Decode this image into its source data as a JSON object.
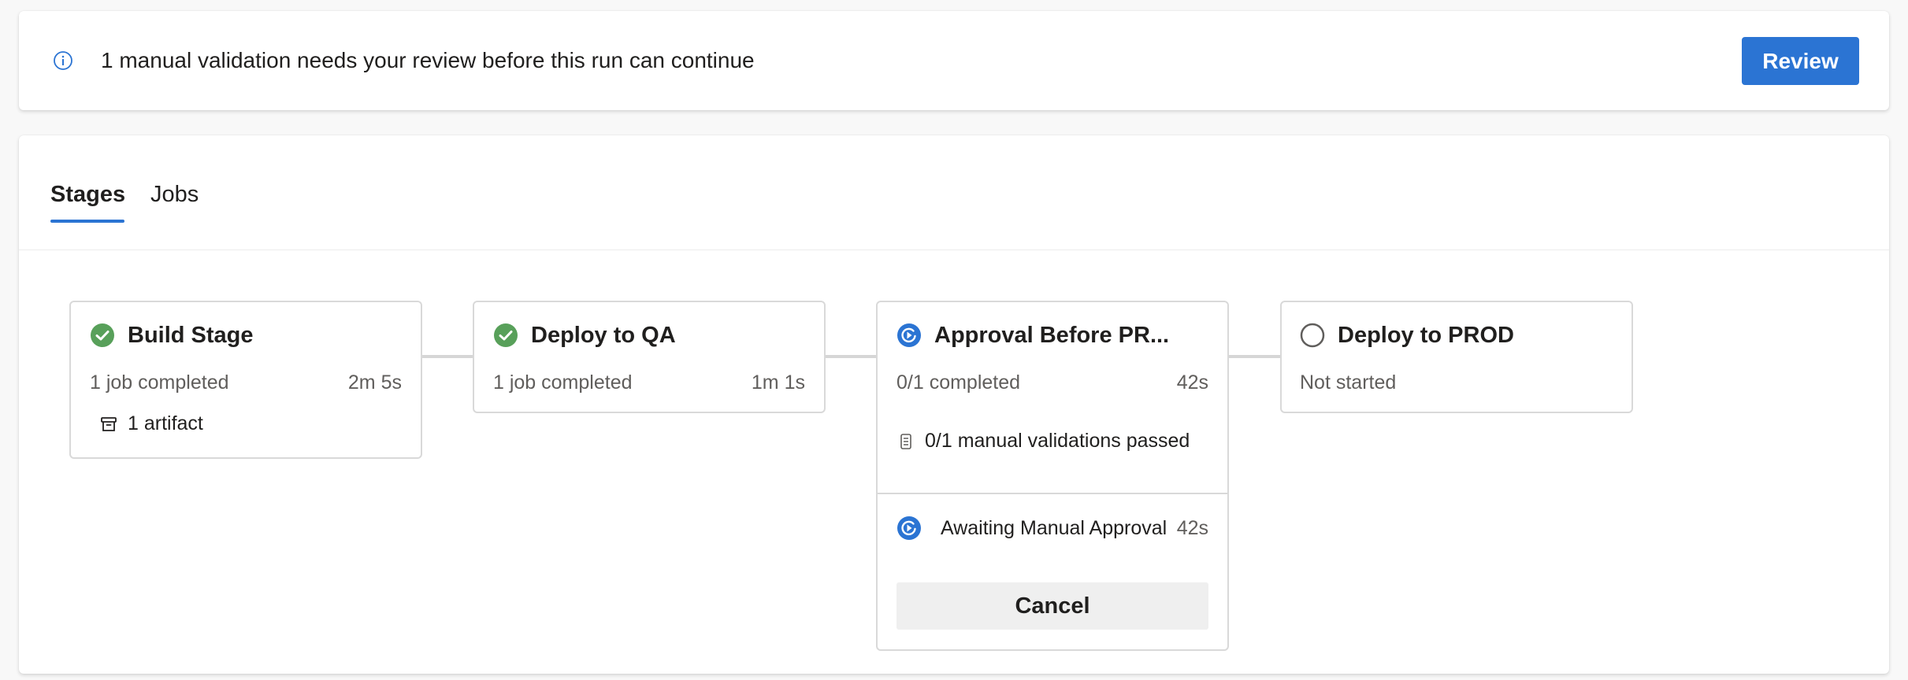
{
  "banner": {
    "icon": "info-icon",
    "message": "1 manual validation needs your review before this run can continue",
    "review_label": "Review"
  },
  "tabs": [
    {
      "label": "Stages",
      "selected": true
    },
    {
      "label": "Jobs",
      "selected": false
    }
  ],
  "stages": [
    {
      "title": "Build Stage",
      "status": "succeeded",
      "status_icon": "check-circle-icon",
      "summary": "1 job completed",
      "duration": "2m 5s",
      "artifact_label": "1 artifact"
    },
    {
      "title": "Deploy to QA",
      "status": "succeeded",
      "status_icon": "check-circle-icon",
      "summary": "1 job completed",
      "duration": "1m 1s"
    },
    {
      "title": "Approval Before PR...",
      "status": "running",
      "status_icon": "running-icon",
      "summary": "0/1 completed",
      "duration": "42s",
      "validation_label": "0/1 manual validations passed",
      "job": {
        "label": "Awaiting Manual Approval",
        "duration": "42s"
      },
      "cancel_label": "Cancel"
    },
    {
      "title": "Deploy to PROD",
      "status": "not-started",
      "status_icon": "empty-circle-icon",
      "summary": "Not started"
    }
  ],
  "colors": {
    "accent": "#2b74d3",
    "success": "#58a05a",
    "running": "#2b74d3",
    "not_started": "#605e5c"
  }
}
